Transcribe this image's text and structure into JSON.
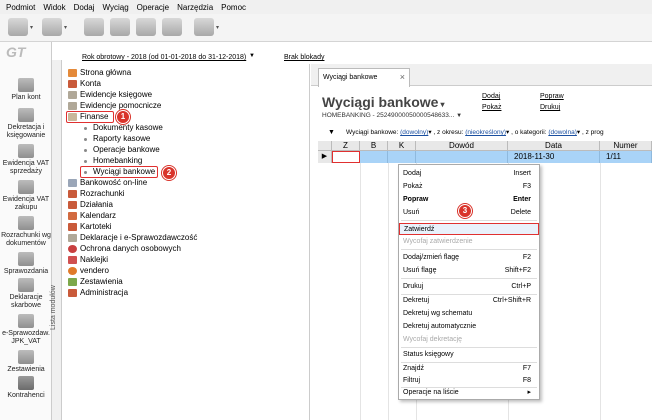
{
  "menubar": [
    "Podmiot",
    "Widok",
    "Dodaj",
    "Wyciąg",
    "Operacje",
    "Narzędzia",
    "Pomoc"
  ],
  "logo": "GT",
  "period": {
    "year": "Rok obrotowy - 2018  (od 01-01-2018 do 31-12-2018)",
    "locks": "Brak blokady"
  },
  "leftnav": [
    {
      "label": "Plan kont"
    },
    {
      "label": "Dekretacja i księgowanie"
    },
    {
      "label": "Ewidencja VAT sprzedaży"
    },
    {
      "label": "Ewidencja VAT zakupu"
    },
    {
      "label": "Rozrachunki wg dokumentów"
    },
    {
      "label": "Sprawozdania"
    },
    {
      "label": "Deklaracje skarbowe"
    },
    {
      "label": "e-Sprawozdaw. JPK_VAT"
    },
    {
      "label": "Zestawienia"
    },
    {
      "label": "Kontrahenci"
    }
  ],
  "strip_label": "Lista modułów",
  "tree": [
    {
      "label": "Strona główna",
      "level": 0
    },
    {
      "label": "Konta",
      "level": 0
    },
    {
      "label": "Ewidencje księgowe",
      "level": 0
    },
    {
      "label": "Ewidencje pomocnicze",
      "level": 0
    },
    {
      "label": "Finanse",
      "level": 0
    },
    {
      "label": "Dokumenty kasowe",
      "level": 1
    },
    {
      "label": "Raporty kasowe",
      "level": 1
    },
    {
      "label": "Operacje bankowe",
      "level": 1
    },
    {
      "label": "Homebanking",
      "level": 1
    },
    {
      "label": "Wyciągi bankowe",
      "level": 1
    },
    {
      "label": "Bankowość on-line",
      "level": 0
    },
    {
      "label": "Rozrachunki",
      "level": 0
    },
    {
      "label": "Działania",
      "level": 0
    },
    {
      "label": "Kalendarz",
      "level": 0
    },
    {
      "label": "Kartoteki",
      "level": 0
    },
    {
      "label": "Deklaracje i e-Sprawozdawczość",
      "level": 0
    },
    {
      "label": "Ochrona danych osobowych",
      "level": 0
    },
    {
      "label": "Naklejki",
      "level": 0
    },
    {
      "label": "vendero",
      "level": 0
    },
    {
      "label": "Zestawienia",
      "level": 0
    },
    {
      "label": "Administracja",
      "level": 0
    }
  ],
  "badges": [
    "1",
    "2",
    "3"
  ],
  "tab": {
    "label": "Wyciągi bankowe",
    "close": "×"
  },
  "panel": {
    "title": "Wyciągi bankowe",
    "subtitle": "HOMEBANKING - 25249000050000548633...",
    "links": [
      "Dodaj",
      "Popraw",
      "Pokaż",
      "Drukuj"
    ]
  },
  "filter": {
    "text1": "Wyciągi bankowe:",
    "v1": "(dowolny)",
    "text2": ", z okresu:",
    "v2": "(nieokreślony)",
    "text3": ", o kategorii:",
    "v3": "(dowolna)",
    "text4": ", z prog"
  },
  "grid": {
    "headers": [
      "Z",
      "B",
      "K",
      "Dowód",
      "Data",
      "Numer"
    ],
    "row": {
      "date": "2018-11-30",
      "number": "1/11"
    }
  },
  "context_menu": [
    {
      "label": "Dodaj",
      "shortcut": "Insert"
    },
    {
      "label": "Pokaż",
      "shortcut": "F3"
    },
    {
      "label": "Popraw",
      "shortcut": "Enter",
      "bold": true
    },
    {
      "label": "Usuń",
      "shortcut": "Delete"
    },
    {
      "label": "Zatwierdź",
      "shortcut": "",
      "highlight": true
    },
    {
      "label": "Wycofaj zatwierdzenie",
      "shortcut": "",
      "disabled": true
    },
    {
      "label": "Dodaj/zmień flagę",
      "shortcut": "F2"
    },
    {
      "label": "Usuń flagę",
      "shortcut": "Shift+F2"
    },
    {
      "label": "Drukuj",
      "shortcut": "Ctrl+P"
    },
    {
      "label": "Dekretuj",
      "shortcut": "Ctrl+Shift+R"
    },
    {
      "label": "Dekretuj wg schematu",
      "shortcut": ""
    },
    {
      "label": "Dekretuj automatycznie",
      "shortcut": ""
    },
    {
      "label": "Wycofaj dekretację",
      "shortcut": "",
      "disabled": true
    },
    {
      "label": "Status księgowy",
      "shortcut": ""
    },
    {
      "label": "Znajdź",
      "shortcut": "F7"
    },
    {
      "label": "Filtruj",
      "shortcut": "F8"
    },
    {
      "label": "Operacje na liście",
      "shortcut": "▸"
    }
  ]
}
